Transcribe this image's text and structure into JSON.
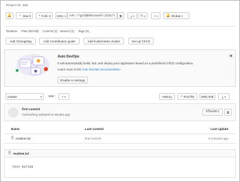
{
  "project": {
    "id_label": "Project ID: 286"
  },
  "toolbar": {
    "star_label": "Star",
    "star_count": "0",
    "fork_label": "Fork",
    "fork_count": "0",
    "protocol_label": "SSH",
    "clone_url": "ssh://git@debianatk:2222/t",
    "global_label": "Global"
  },
  "stats": {
    "readme": "Readme",
    "files": "Files (82 KB)",
    "commits": "Commit (1)",
    "branches": "Branch (1)",
    "tags": "Tags (0)"
  },
  "actions": {
    "changelog": "Add Changelog",
    "contribution": "Add Contribution guide",
    "kubernetes": "Add Kubernetes cluster",
    "cicd": "Set up CI/CD"
  },
  "autodevops": {
    "title": "Auto DevOps",
    "description": "It will automatically build, test, and deploy your application based on a predefined CI/CD configuration.",
    "learn_prefix": "Learn more in the",
    "learn_link": "Auto DevOps documentation",
    "enable_button": "Enable in settings"
  },
  "repo_nav": {
    "branch": "master",
    "path": "test",
    "path_sep": "/",
    "add": "+",
    "history": "History",
    "find_file": "Find file",
    "web_ide": "Web IDE"
  },
  "last_commit": {
    "title": "first commit",
    "meta": "CaiXuefeng authored 6 minutes ago",
    "sha": "4f6a39c1"
  },
  "file_table": {
    "headers": {
      "name": "Name",
      "last_commit": "Last commit",
      "last_update": "Last update"
    },
    "rows": [
      {
        "name": "readme.txt",
        "commit": "first commit",
        "update": "6 minutes ago"
      }
    ]
  },
  "readme": {
    "filename": "readme.txt",
    "content": "test Gitlab"
  },
  "colors": {
    "link": "#1f78d1",
    "border": "#d0d0d0",
    "banner_bg": "#fafafa"
  }
}
